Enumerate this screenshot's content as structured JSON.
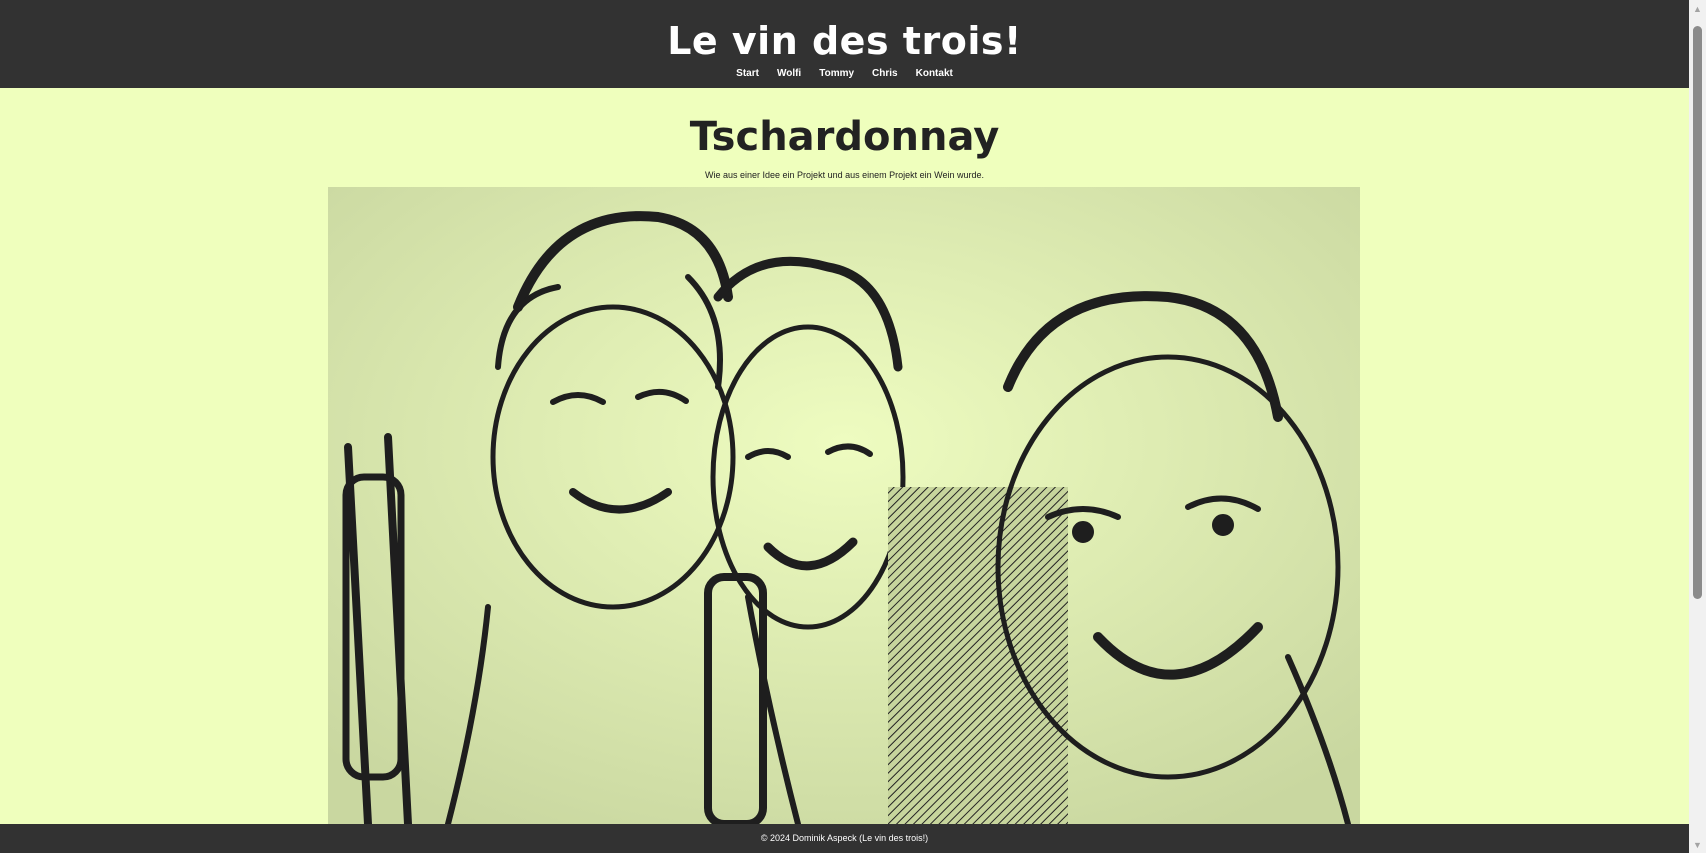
{
  "header": {
    "title": "Le vin des trois!",
    "nav": [
      "Start",
      "Wolfi",
      "Tommy",
      "Chris",
      "Kontakt"
    ]
  },
  "main": {
    "heading": "Tschardonnay",
    "subtitle": "Wie aus einer Idee ein Projekt und aus einem Projekt ein Wein wurde."
  },
  "footer": {
    "text": "© 2024 Dominik Aspeck (Le vin des trois!)"
  },
  "colors": {
    "header_bg": "#323232",
    "page_bg": "#efffbd",
    "ink": "#222222"
  },
  "icons": {
    "scroll_up": "triangle-up-icon",
    "scroll_down": "triangle-down-icon"
  }
}
